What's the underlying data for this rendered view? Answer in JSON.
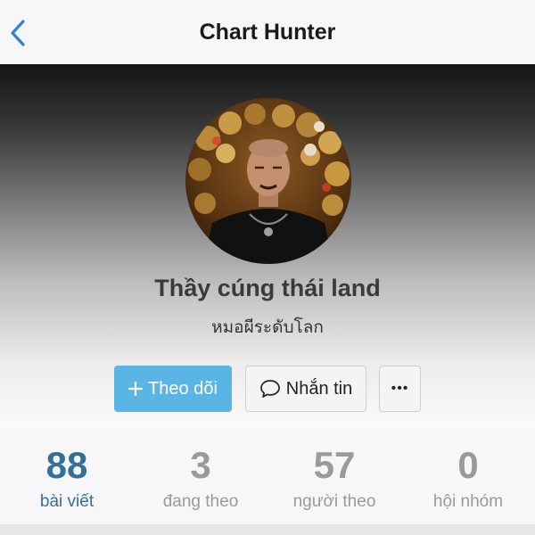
{
  "header": {
    "title": "Chart Hunter",
    "back_icon": "chevron-left-icon"
  },
  "profile": {
    "name": "Thầy cúng thái land",
    "subtitle": "หมอผีระดับโลก"
  },
  "actions": {
    "follow_label": "Theo dõi",
    "follow_icon": "plus-icon",
    "message_label": "Nhắn tin",
    "message_icon": "chat-bubble-icon",
    "more_label": "•••"
  },
  "stats": [
    {
      "value": "88",
      "label": "bài viết"
    },
    {
      "value": "3",
      "label": "đang theo"
    },
    {
      "value": "57",
      "label": "người theo"
    },
    {
      "value": "0",
      "label": "hội nhóm"
    }
  ],
  "colors": {
    "accent": "#5ab4e4",
    "active_stat": "#356f9c",
    "back_icon": "#2f80d8"
  }
}
